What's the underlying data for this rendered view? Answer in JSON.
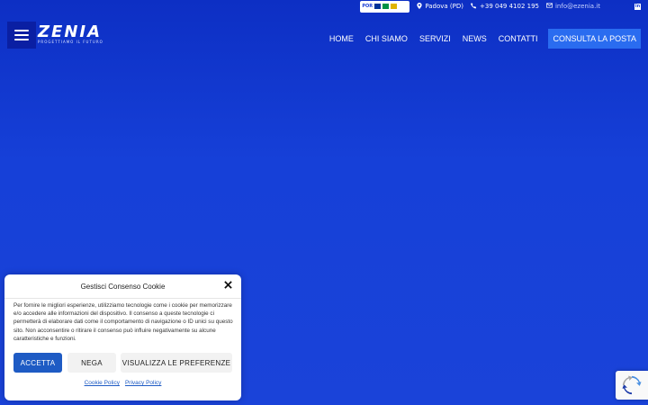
{
  "topbar": {
    "por_logo_text": "POR",
    "location": "Padova (PD)",
    "phone": "+39 049 4102 195",
    "email": "info@ezenia.it",
    "icons": {
      "location": "map-marker-icon",
      "phone": "phone-icon",
      "email": "envelope-icon",
      "social": "linkedin-icon"
    }
  },
  "header": {
    "logo_name": "ZENIA",
    "logo_tagline": "PROGETTIAMO IL FUTURO",
    "menu_icon": "hamburger-icon",
    "nav": [
      {
        "label": "HOME"
      },
      {
        "label": "CHI SIAMO"
      },
      {
        "label": "SERVIZI"
      },
      {
        "label": "NEWS"
      },
      {
        "label": "CONTATTI"
      }
    ],
    "cta_label": "CONSULTA LA POSTA"
  },
  "cookie": {
    "title": "Gestisci Consenso Cookie",
    "text": "Per fornire le migliori esperienze, utilizziamo tecnologie come i cookie per memorizzare e/o accedere alle informazioni del dispositivo. Il consenso a queste tecnologie ci permetterà di elaborare dati come il comportamento di navigazione o ID unici su questo sito. Non acconsentire o ritirare il consenso può influire negativamente su alcune caratteristiche e funzioni.",
    "accept_label": "ACCETTA",
    "deny_label": "NEGA",
    "prefs_label": "VISUALIZZA LE PREFERENZE",
    "cookie_policy": "Cookie Policy",
    "privacy_policy": "Privacy Policy",
    "close_icon": "close-icon"
  },
  "colors": {
    "background": "#1a3fd6",
    "accent": "#1e5bc4",
    "cta": "#2a6cf0",
    "menu_button": "#0a1fa3"
  }
}
